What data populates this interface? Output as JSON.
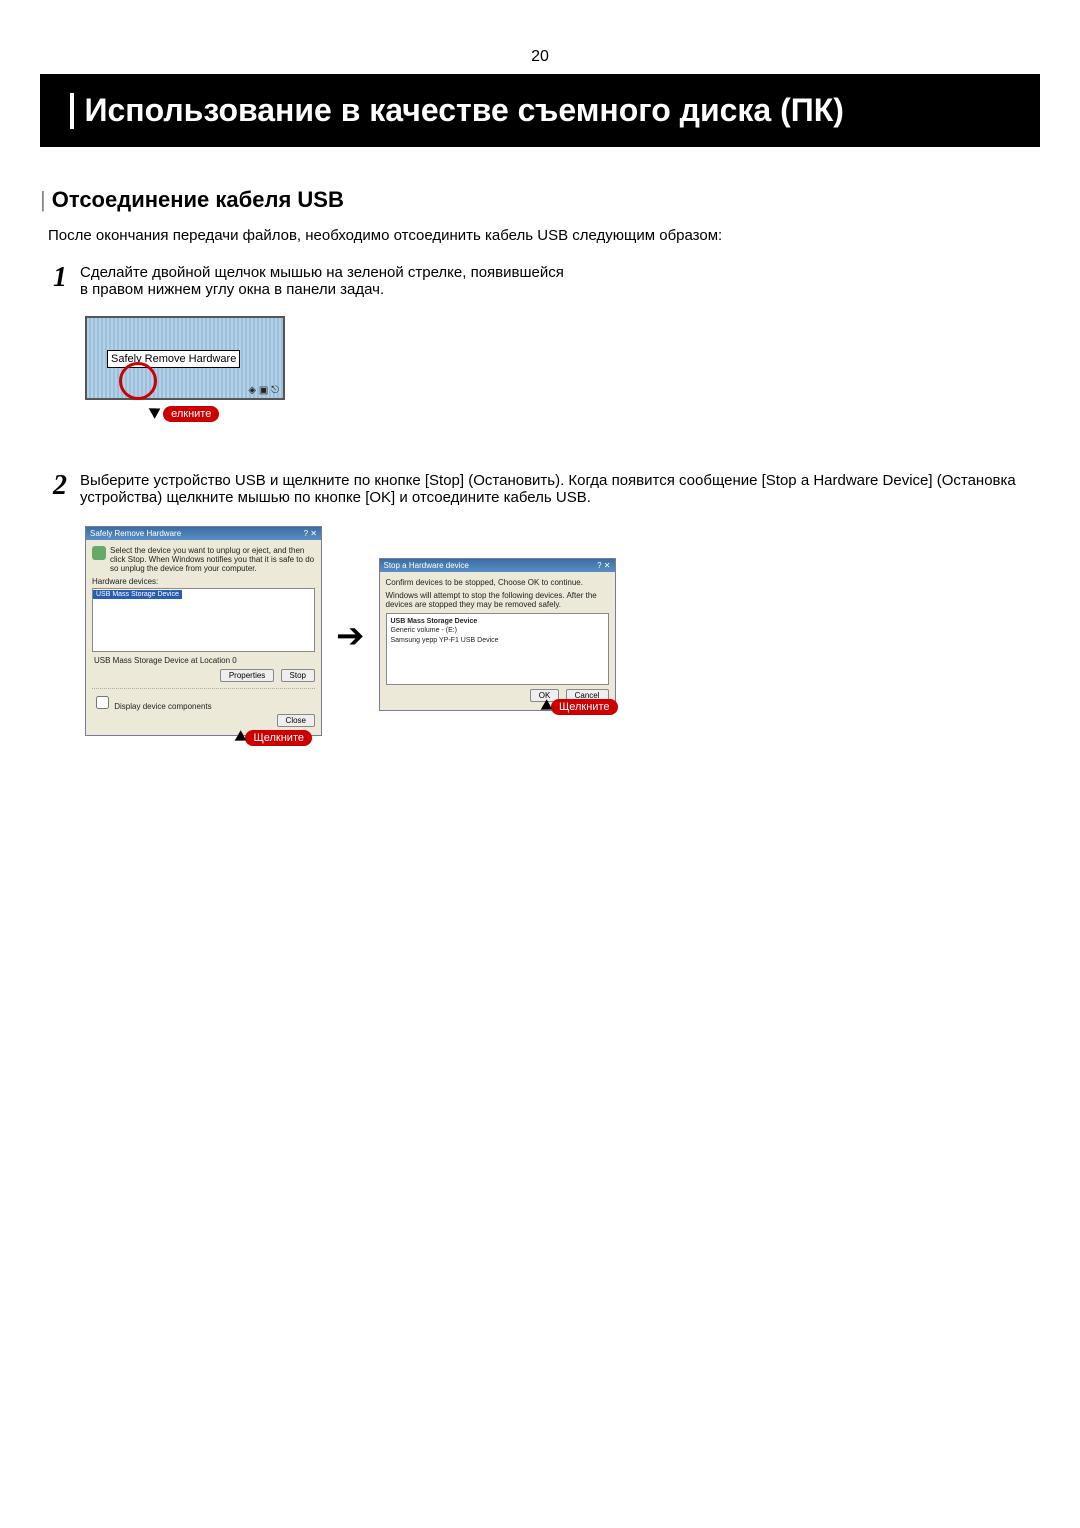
{
  "page_number": "20",
  "title": "Использование в качестве съемного диска (ПК)",
  "section": "Отсоединение кабеля USB",
  "intro": "После окончания передачи файлов, необходимо отсоединить кабель USB следующим образом:",
  "steps": {
    "s1": {
      "num": "1",
      "line1": "Сделайте двойной щелчок мышью на зеленой стрелке, появившейся",
      "line2": "в правом нижнем углу окна в панели задач."
    },
    "s2": {
      "num": "2",
      "text": "Выберите устройство USB и щелкните по кнопке [Stop] (Остановить). Когда появится сообщение [Stop a Hardware Device] (Остановка устройства) щелкните мышью по кнопке [OK] и отсоедините кабель USB."
    }
  },
  "tray": {
    "balloon": "Safely Remove Hardware",
    "click_label": "елкните"
  },
  "dlg1": {
    "title": "Safely Remove Hardware",
    "help_close": "? ✕",
    "info": "Select the device you want to unplug or eject, and then click Stop. When Windows notifies you that it is safe to do so unplug the device from your computer.",
    "hw_label": "Hardware devices:",
    "selected": "USB Mass Storage Device",
    "at_location": "USB Mass Storage Device at Location 0",
    "btn_properties": "Properties",
    "btn_stop": "Stop",
    "chk": "Display device components",
    "btn_close": "Close",
    "click_label": "Щелкните"
  },
  "dlg2": {
    "title": "Stop a Hardware device",
    "help_close": "? ✕",
    "line1": "Confirm devices to be stopped, Choose OK to continue.",
    "line2": "Windows will attempt to stop the following devices. After the devices are stopped they may be removed safely.",
    "dev1": "USB Mass Storage Device",
    "dev2": "Generic volume - (E:)",
    "dev3": "Samsung yepp  YP-F1  USB Device",
    "btn_ok": "OK",
    "btn_cancel": "Cancel",
    "click_label": "Щелкните"
  }
}
